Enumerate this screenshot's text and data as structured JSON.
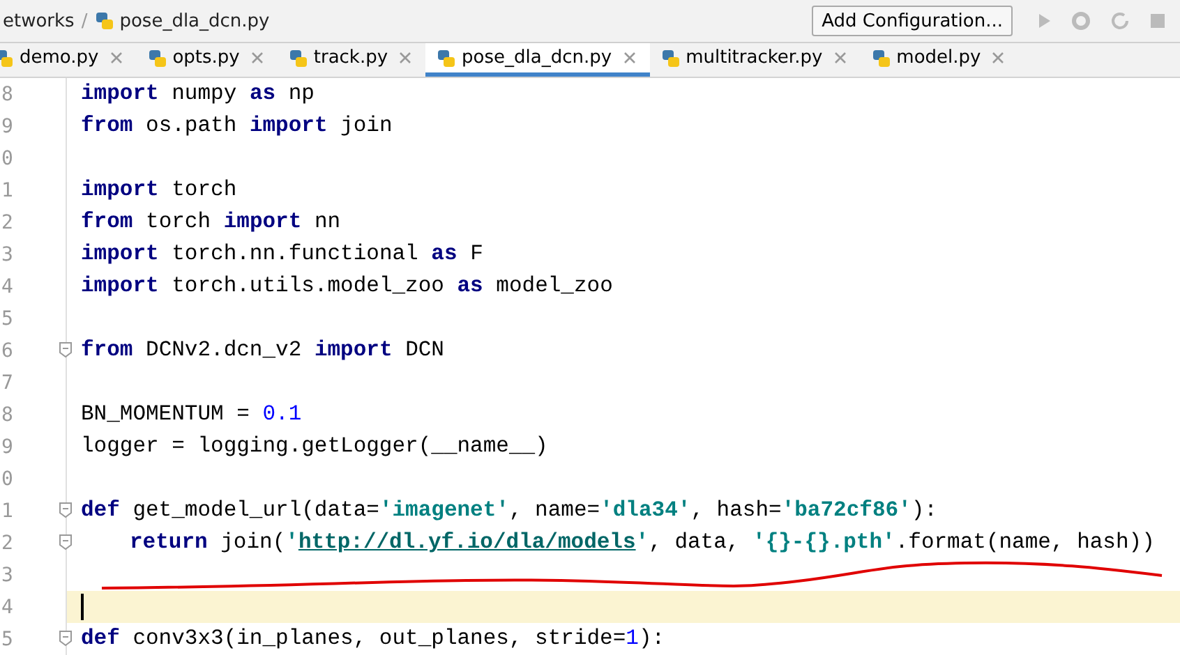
{
  "breadcrumb": {
    "items": [
      "etworks",
      "pose_dla_dcn.py"
    ],
    "separator": "/"
  },
  "run_config": {
    "label": "Add Configuration..."
  },
  "tabs": [
    {
      "label": "demo.py",
      "selected": false
    },
    {
      "label": "opts.py",
      "selected": false
    },
    {
      "label": "track.py",
      "selected": false
    },
    {
      "label": "pose_dla_dcn.py",
      "selected": true
    },
    {
      "label": "multitracker.py",
      "selected": false
    },
    {
      "label": "model.py",
      "selected": false
    }
  ],
  "editor": {
    "lines": [
      {
        "number": "8",
        "current": false,
        "fold": false,
        "tokens": [
          {
            "kind": "keyword",
            "text": "import"
          },
          {
            "kind": "plain",
            "text": " numpy "
          },
          {
            "kind": "keyword",
            "text": "as"
          },
          {
            "kind": "plain",
            "text": " np"
          }
        ]
      },
      {
        "number": "9",
        "current": false,
        "fold": false,
        "tokens": [
          {
            "kind": "keyword",
            "text": "from"
          },
          {
            "kind": "plain",
            "text": " os.path "
          },
          {
            "kind": "keyword",
            "text": "import"
          },
          {
            "kind": "plain",
            "text": " join"
          }
        ]
      },
      {
        "number": "0",
        "current": false,
        "fold": false
      },
      {
        "number": "1",
        "current": false,
        "fold": false,
        "tokens": [
          {
            "kind": "keyword",
            "text": "import"
          },
          {
            "kind": "plain",
            "text": " torch"
          }
        ]
      },
      {
        "number": "2",
        "current": false,
        "fold": false,
        "tokens": [
          {
            "kind": "keyword",
            "text": "from"
          },
          {
            "kind": "plain",
            "text": " torch "
          },
          {
            "kind": "keyword",
            "text": "import"
          },
          {
            "kind": "plain",
            "text": " nn"
          }
        ]
      },
      {
        "number": "3",
        "current": false,
        "fold": false,
        "tokens": [
          {
            "kind": "keyword",
            "text": "import"
          },
          {
            "kind": "plain",
            "text": " torch.nn.functional "
          },
          {
            "kind": "keyword",
            "text": "as"
          },
          {
            "kind": "plain",
            "text": " F"
          }
        ]
      },
      {
        "number": "4",
        "current": false,
        "fold": false,
        "tokens": [
          {
            "kind": "keyword",
            "text": "import"
          },
          {
            "kind": "plain",
            "text": " torch.utils.model_zoo "
          },
          {
            "kind": "keyword",
            "text": "as"
          },
          {
            "kind": "plain",
            "text": " model_zoo"
          }
        ]
      },
      {
        "number": "5",
        "current": false,
        "fold": false
      },
      {
        "number": "6",
        "current": false,
        "fold": true,
        "tokens": [
          {
            "kind": "keyword",
            "text": "from"
          },
          {
            "kind": "plain",
            "text": " DCNv2.dcn_v2 "
          },
          {
            "kind": "keyword",
            "text": "import"
          },
          {
            "kind": "plain",
            "text": " DCN"
          }
        ]
      },
      {
        "number": "7",
        "current": false,
        "fold": false
      },
      {
        "number": "8",
        "current": false,
        "fold": false,
        "tokens": [
          {
            "kind": "plain",
            "text": "BN_MOMENTUM = "
          },
          {
            "kind": "number",
            "text": "0.1"
          }
        ]
      },
      {
        "number": "9",
        "current": false,
        "fold": false,
        "tokens": [
          {
            "kind": "plain",
            "text": "logger = logging.getLogger(__name__)"
          }
        ]
      },
      {
        "number": "0",
        "current": false,
        "fold": false
      },
      {
        "number": "1",
        "current": false,
        "fold": true,
        "tokens": [
          {
            "kind": "keyword",
            "text": "def"
          },
          {
            "kind": "plain",
            "text": " get_model_url(data="
          },
          {
            "kind": "string",
            "text": "'imagenet'"
          },
          {
            "kind": "plain",
            "text": ", name="
          },
          {
            "kind": "string",
            "text": "'dla34'"
          },
          {
            "kind": "plain",
            "text": ", hash="
          },
          {
            "kind": "string",
            "text": "'ba72cf86'"
          },
          {
            "kind": "plain",
            "text": "):"
          }
        ]
      },
      {
        "number": "2",
        "current": false,
        "fold": true,
        "indented": true,
        "tokens": [
          {
            "kind": "keyword",
            "text": "return"
          },
          {
            "kind": "plain",
            "text": " join("
          },
          {
            "kind": "string",
            "text": "'"
          },
          {
            "kind": "url",
            "text": "http://dl.yf.io/dla/models"
          },
          {
            "kind": "string",
            "text": "'"
          },
          {
            "kind": "plain",
            "text": ", data, "
          },
          {
            "kind": "string",
            "text": "'{}-{}.pth'"
          },
          {
            "kind": "plain",
            "text": ".format(name, hash))"
          }
        ]
      },
      {
        "number": "3",
        "current": false,
        "fold": false
      },
      {
        "number": "4",
        "current": true,
        "fold": false
      },
      {
        "number": "5",
        "current": false,
        "fold": true,
        "tokens": [
          {
            "kind": "keyword",
            "text": "def"
          },
          {
            "kind": "plain",
            "text": " conv3x3(in_planes, out_planes, stride="
          },
          {
            "kind": "number",
            "text": "1"
          },
          {
            "kind": "plain",
            "text": "):"
          }
        ]
      }
    ]
  }
}
